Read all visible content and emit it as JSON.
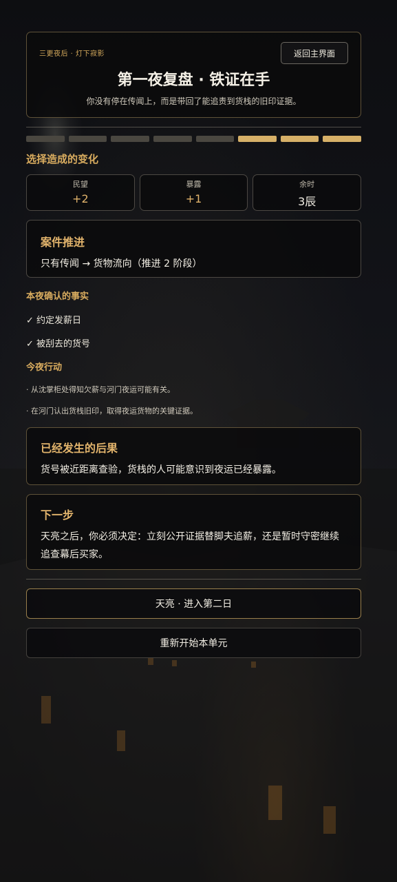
{
  "header": {
    "kicker": "三更夜后 · 灯下寂影",
    "back_label": "返回主界面",
    "title": "第一夜复盘 · 铁证在手",
    "subtitle": "你没有停在传闻上，而是带回了能追责到货栈的旧印证据。"
  },
  "progress": {
    "total": 8,
    "filled": 3
  },
  "changes": {
    "title": "选择造成的变化",
    "stats": [
      {
        "label": "民望",
        "value": "+2",
        "tone": "gold"
      },
      {
        "label": "暴露",
        "value": "+1",
        "tone": "gold"
      },
      {
        "label": "余时",
        "value": "3辰",
        "tone": "white"
      }
    ]
  },
  "case": {
    "title": "案件推进",
    "body": "只有传闻 → 货物流向（推进 2 阶段）"
  },
  "facts": {
    "title": "本夜确认的事实",
    "items": [
      "✓ 约定发薪日",
      "✓ 被刮去的货号"
    ]
  },
  "actions": {
    "title": "今夜行动",
    "items": [
      "· 从沈掌柜处得知欠薪与河门夜运可能有关。",
      "· 在河门认出货栈旧印，取得夜运货物的关键证据。"
    ]
  },
  "consequence": {
    "title": "已经发生的后果",
    "body": "货号被近距离查验，货栈的人可能意识到夜运已经暴露。"
  },
  "next": {
    "title": "下一步",
    "body": "天亮之后，你必须决定：立刻公开证据替脚夫追薪，还是暂时守密继续追查幕后买家。"
  },
  "buttons": {
    "continue_label": "天亮 · 进入第二日",
    "restart_label": "重新开始本单元"
  }
}
